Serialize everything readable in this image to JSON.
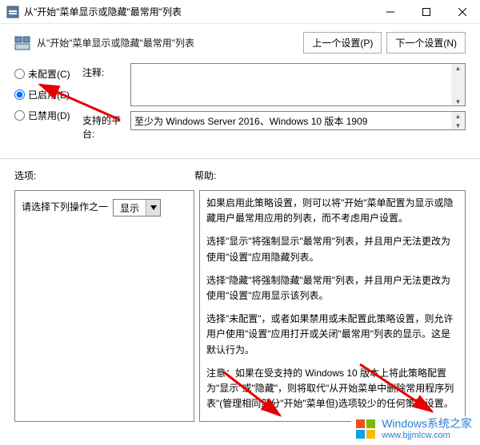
{
  "window": {
    "title": "从\"开始\"菜单显示或隐藏\"最常用\"列表"
  },
  "header": {
    "title": "从\"开始\"菜单显示或隐藏\"最常用\"列表",
    "prev_btn": "上一个设置(P)",
    "next_btn": "下一个设置(N)"
  },
  "radios": {
    "not_configured": "未配置(C)",
    "enabled": "已启用(E)",
    "disabled": "已禁用(D)",
    "selected": "enabled"
  },
  "config": {
    "comment_label": "注释:",
    "comment_value": "",
    "platform_label": "支持的平台:",
    "platform_value": "至少为 Windows Server 2016、Windows 10 版本 1909"
  },
  "labels": {
    "options": "选项:",
    "help": "帮助:"
  },
  "options": {
    "inner_label": "请选择下列操作之一",
    "select_value": "显示"
  },
  "help": {
    "p1": "如果启用此策略设置，则可以将\"开始\"菜单配置为显示或隐藏用户最常用应用的列表，而不考虑用户设置。",
    "p2": "选择\"显示\"将强制显示\"最常用\"列表，并且用户无法更改为使用\"设置\"应用隐藏列表。",
    "p3": "选择\"隐藏\"将强制隐藏\"最常用\"列表，并且用户无法更改为使用\"设置\"应用显示该列表。",
    "p4": "选择\"未配置\"，或者如果禁用或未配置此策略设置，则允许用户使用\"设置\"应用打开或关闭\"最常用\"列表的显示。这是默认行为。",
    "p5": "注意：如果在受支持的 Windows 10 版本上将此策略配置为\"显示\"或\"隐藏\"，则将取代\"从开始菜单中删除常用程序列表\"(管理相同部分\"开始\"菜单但)选项较少的任何策略设置。"
  },
  "watermark": {
    "brand": "Windows",
    "suffix": "系统之家",
    "url": "www.bjjmlcw.com"
  }
}
